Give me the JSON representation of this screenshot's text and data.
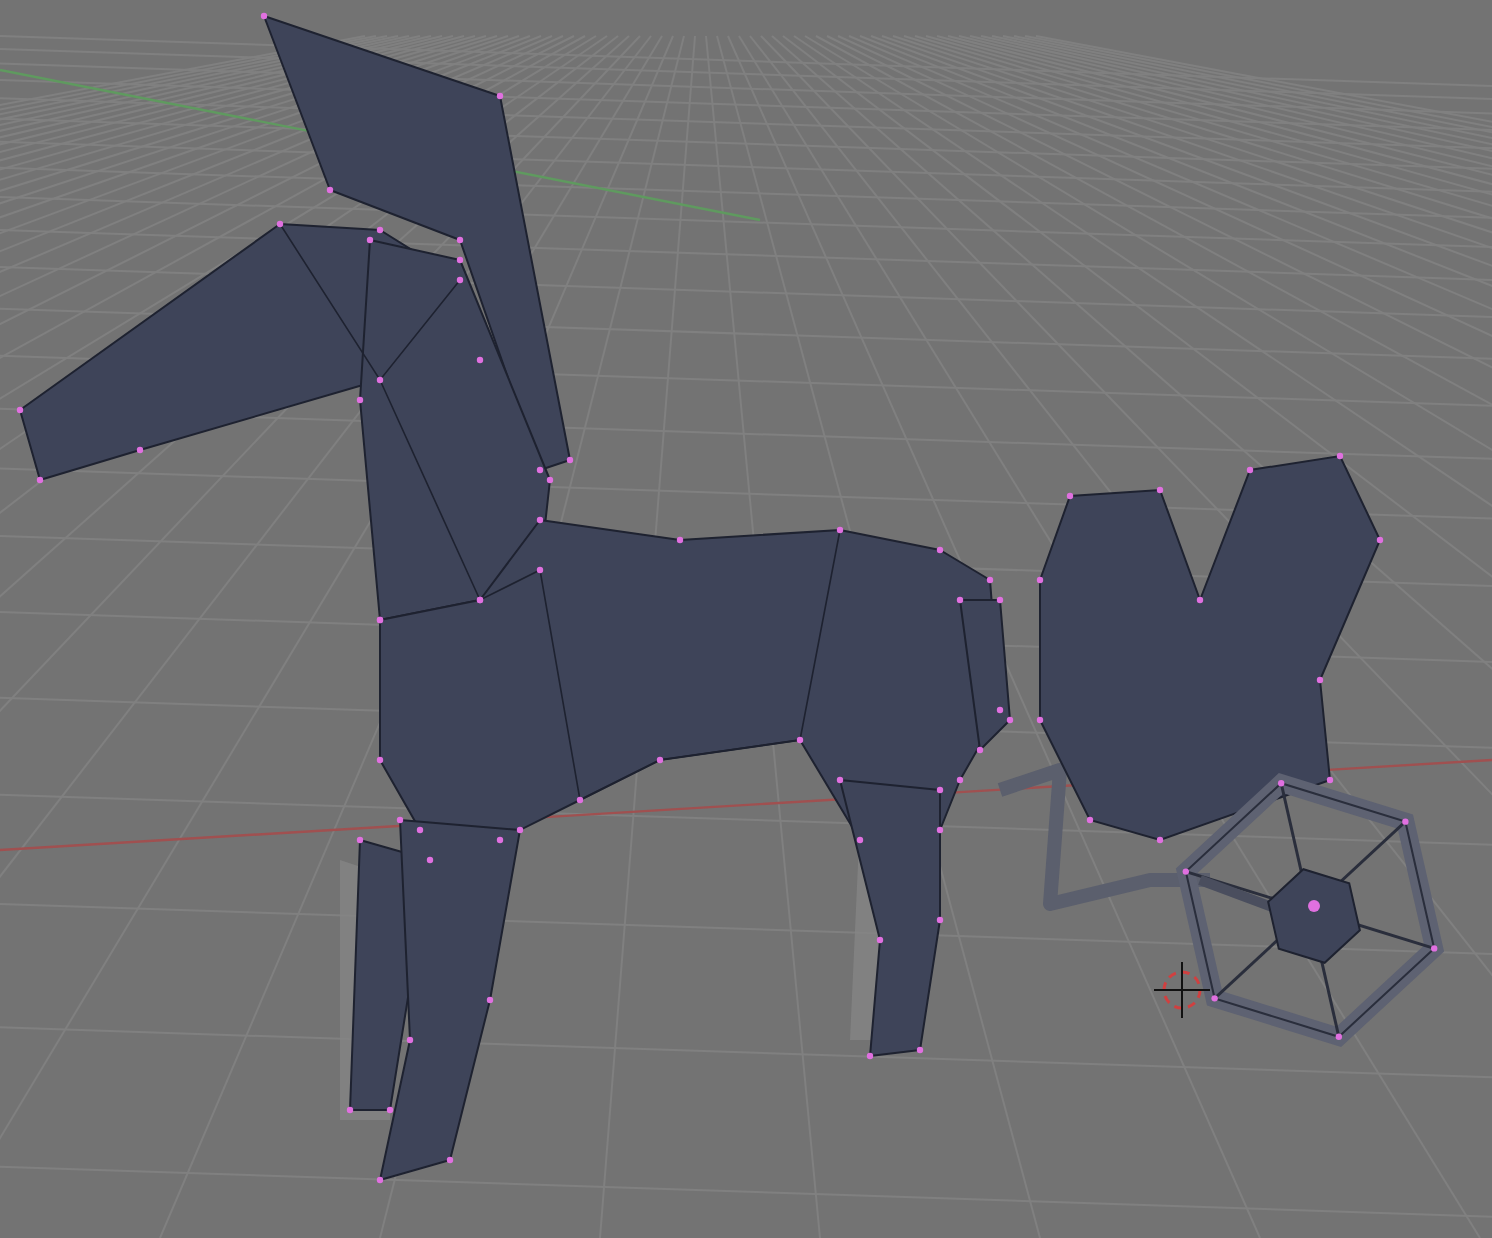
{
  "viewport": {
    "show_grid": true,
    "show_axes": true,
    "show_3d_cursor": true,
    "show_vertices": true
  }
}
